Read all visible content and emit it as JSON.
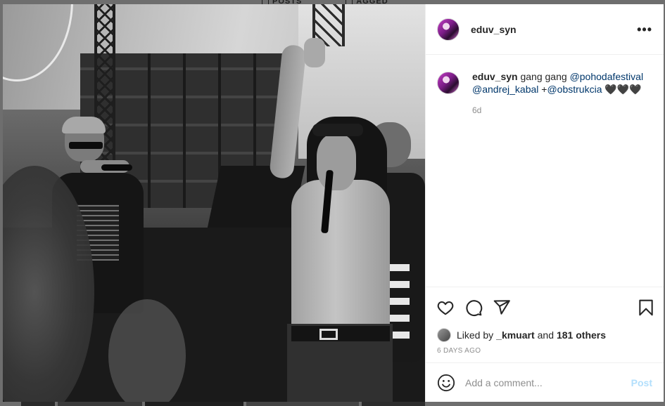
{
  "background": {
    "tabs": [
      {
        "label": "POSTS",
        "icon": "grid-icon"
      },
      {
        "label": "AGGED",
        "icon": "tag-icon"
      }
    ]
  },
  "post": {
    "photo_alt": "Black and white concert photo",
    "author": {
      "username": "eduv_syn",
      "avatar_icon": "profile-avatar"
    },
    "more_icon": "more-options-icon",
    "caption": {
      "username": "eduv_syn",
      "text_before": " gang gang ",
      "mention1": "@pohodafestival",
      "mention2": "@andrej_kabal",
      "plus": " +",
      "mention3": "@obstrukcia",
      "emoji": " 🖤🖤🖤",
      "time": "6d"
    },
    "actions": {
      "like_icon": "heart-icon",
      "comment_icon": "comment-icon",
      "share_icon": "send-icon",
      "save_icon": "bookmark-icon"
    },
    "likes": {
      "prefix": "Liked by",
      "user": "_kmuart",
      "conj": "and",
      "others": "181 others"
    },
    "date": "6 DAYS AGO",
    "comment_box": {
      "placeholder": "Add a comment...",
      "post_label": "Post",
      "emoji_icon": "smiley-icon"
    }
  },
  "colors": {
    "mention": "#00376b",
    "post_button_disabled": "#b2dffc",
    "secondary_text": "#8e8e8e"
  }
}
